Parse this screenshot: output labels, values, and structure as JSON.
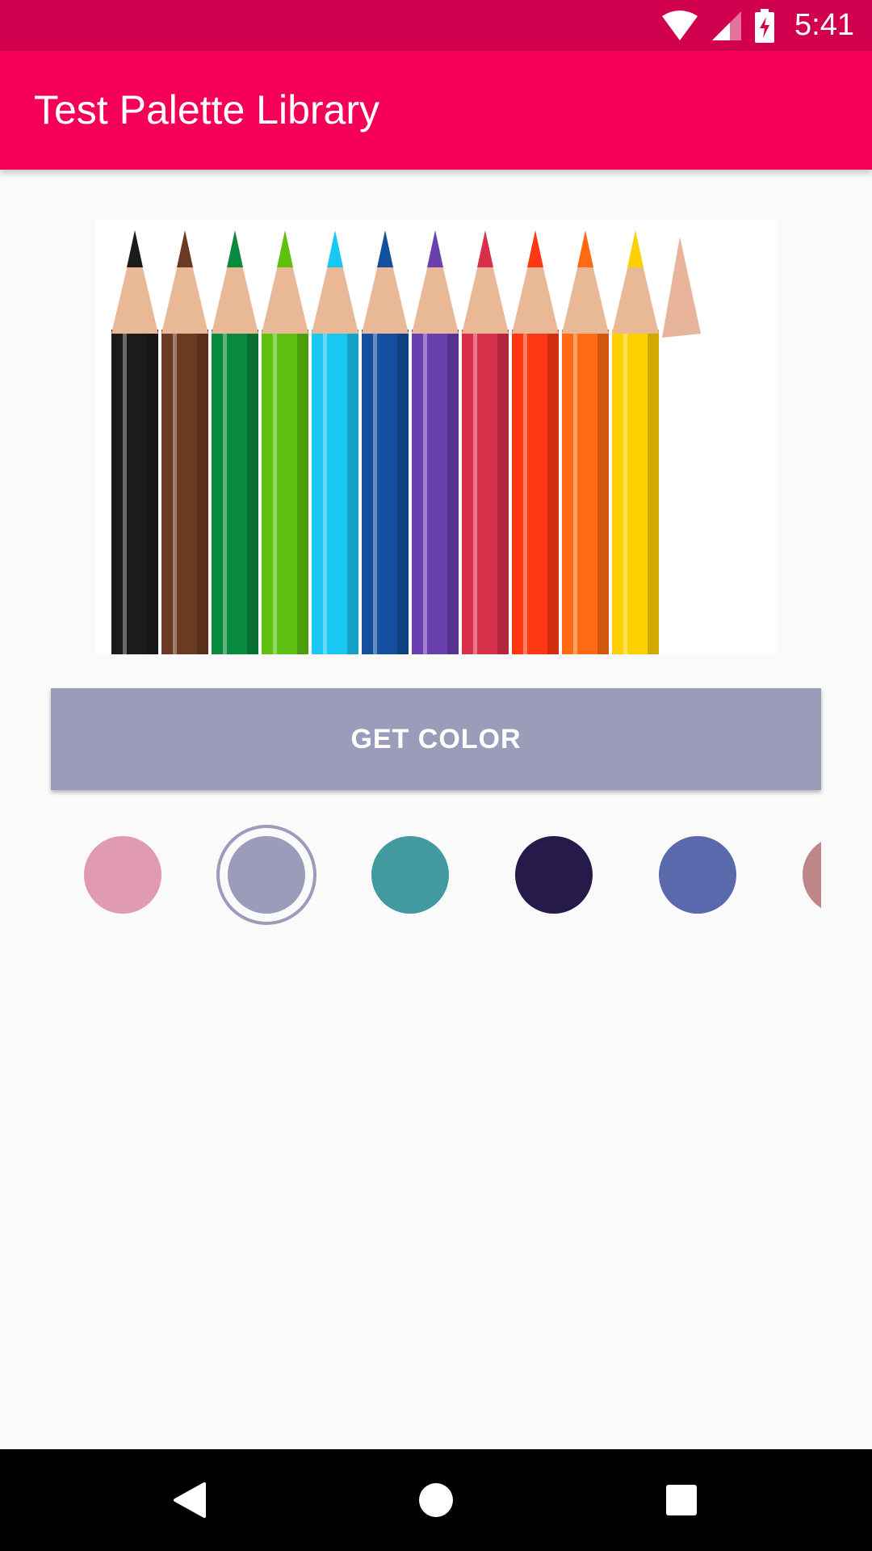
{
  "status_bar": {
    "time": "5:41",
    "icons": [
      "wifi-icon",
      "signal-icon",
      "battery-charging-icon"
    ],
    "background": "#d1004e"
  },
  "app_bar": {
    "title": "Test Palette Library",
    "background": "#f50057"
  },
  "image": {
    "subject": "colored-pencils",
    "pencil_colors": [
      "#1b1b1b",
      "#6b3a22",
      "#0a8a3e",
      "#5ec10f",
      "#18c7f2",
      "#1450a0",
      "#6a3fb0",
      "#d8304a",
      "#ff3814",
      "#ff6a12",
      "#ffd000"
    ]
  },
  "button": {
    "label": "GET COLOR",
    "background": "#9a9cba"
  },
  "swatches": [
    {
      "color": "#e09ab1",
      "selected": false
    },
    {
      "color": "#9a9cba",
      "selected": true
    },
    {
      "color": "#419aa0",
      "selected": false
    },
    {
      "color": "#261a4a",
      "selected": false
    },
    {
      "color": "#5a69ab",
      "selected": false
    },
    {
      "color": "#bf8689",
      "selected": false
    }
  ],
  "nav_bar": {
    "buttons": [
      "back-icon",
      "home-icon",
      "recents-icon"
    ]
  }
}
